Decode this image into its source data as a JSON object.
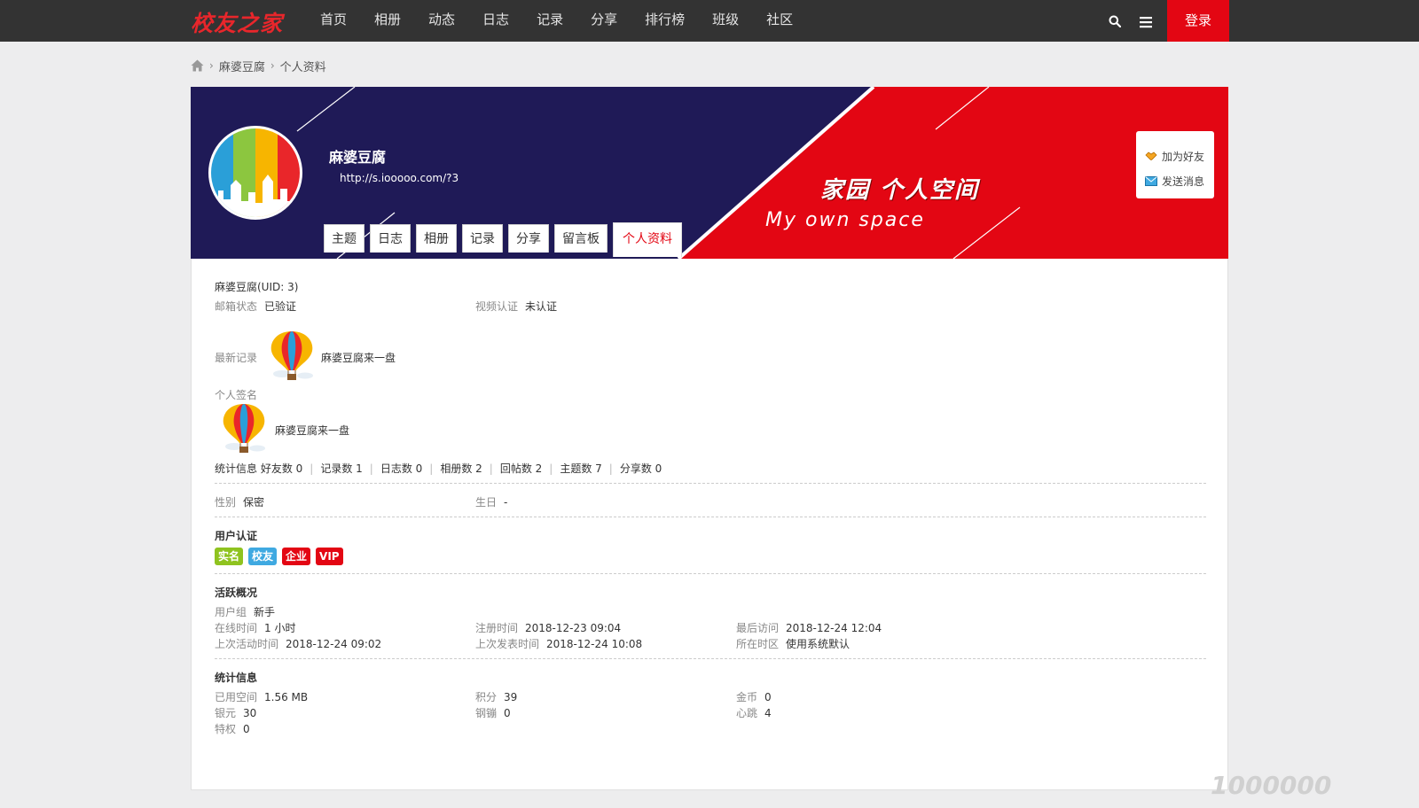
{
  "site": {
    "logo": "校友之家",
    "nav": [
      "首页",
      "相册",
      "动态",
      "日志",
      "记录",
      "分享",
      "排行榜",
      "班级",
      "社区"
    ],
    "login": "登录"
  },
  "breadcrumb": {
    "items": [
      "麻婆豆腐",
      "个人资料"
    ]
  },
  "profile": {
    "name": "麻婆豆腐",
    "url": "http://s.iooooo.com/?3",
    "tabs": [
      "主题",
      "日志",
      "相册",
      "记录",
      "分享",
      "留言板",
      "个人资料"
    ],
    "active_tab": "个人资料",
    "slogan_cn": "家园  个人空间",
    "slogan_en": "My own space",
    "actions": {
      "add_friend": "加为好友",
      "send_message": "发送消息"
    }
  },
  "info": {
    "name_uid": "麻婆豆腐(UID: 3)",
    "email_label": "邮箱状态",
    "email_value": "已验证",
    "video_label": "视频认证",
    "video_value": "未认证",
    "latest_record_label": "最新记录",
    "latest_record_value": "麻婆豆腐来一盘",
    "signature_label": "个人签名",
    "signature_value": "麻婆豆腐来一盘",
    "stats_label": "统计信息",
    "stats": [
      "好友数 0",
      "记录数 1",
      "日志数 0",
      "相册数 2",
      "回帖数 2",
      "主题数 7",
      "分享数 0"
    ],
    "gender_label": "性别",
    "gender_value": "保密",
    "birthday_label": "生日",
    "birthday_value": "-",
    "cert_title": "用户认证",
    "badges": [
      {
        "text": "实名",
        "color": "#8fc31f"
      },
      {
        "text": "校友",
        "color": "#3fa9e1"
      },
      {
        "text": "企业",
        "color": "#e30613"
      },
      {
        "text": "VIP",
        "color": "#e30613"
      }
    ],
    "activity_title": "活跃概况",
    "usergroup_label": "用户组",
    "usergroup_value": "新手",
    "online_label": "在线时间",
    "online_value": "1 小时",
    "register_label": "注册时间",
    "register_value": "2018-12-23 09:04",
    "last_visit_label": "最后访问",
    "last_visit_value": "2018-12-24 12:04",
    "last_active_label": "上次活动时间",
    "last_active_value": "2018-12-24 09:02",
    "last_post_label": "上次发表时间",
    "last_post_value": "2018-12-24 10:08",
    "timezone_label": "所在时区",
    "timezone_value": "使用系统默认",
    "stats_title": "统计信息",
    "space_label": "已用空间",
    "space_value": "1.56 MB",
    "points_label": "积分",
    "points_value": "39",
    "gold_label": "金币",
    "gold_value": "0",
    "silver_label": "银元",
    "silver_value": "30",
    "steel_label": "钢镚",
    "steel_value": "0",
    "heart_label": "心跳",
    "heart_value": "4",
    "privilege_label": "特权",
    "privilege_value": "0"
  },
  "watermark": "1000000",
  "colors": {
    "topbar": "#333333",
    "accent": "#e30613",
    "banner_navy": "#1f1a57"
  }
}
